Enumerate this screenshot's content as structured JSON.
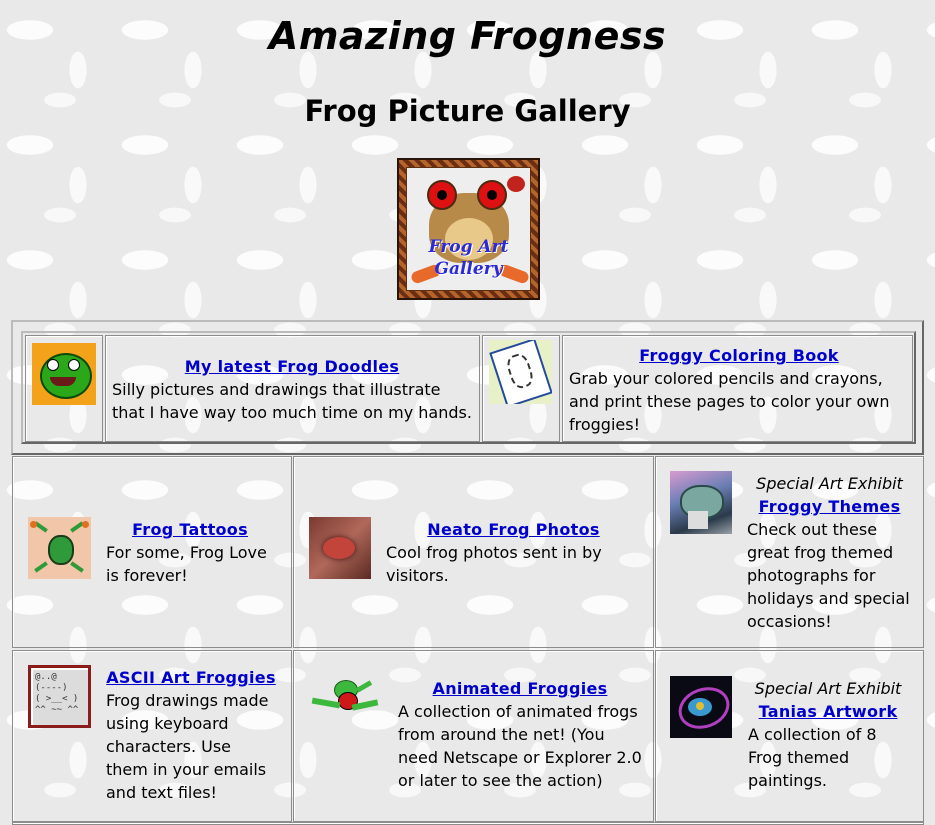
{
  "header": {
    "title": "Amazing Frogness",
    "subtitle": "Frog Picture Gallery"
  },
  "badge": {
    "line1": "Frog Art",
    "line2": "Gallery"
  },
  "featured": [
    {
      "link": "My latest Frog Doodles",
      "description": "Silly pictures and drawings that illustrate that I have way too much time on my hands.",
      "icon": "cartoon-frog-icon"
    },
    {
      "link": "Froggy Coloring Book",
      "description": "Grab your colored pencils and crayons, and print these pages to color your own froggies!",
      "icon": "coloring-book-icon"
    }
  ],
  "gallery": [
    {
      "link": "Frog Tattoos",
      "description": "For some, Frog Love is forever!",
      "icon": "frog-tattoo-icon"
    },
    {
      "link": "Neato Frog Photos",
      "description": "Cool frog photos sent in by visitors.",
      "icon": "frog-photo-icon"
    },
    {
      "exhibit": "Special Art Exhibit",
      "link": "Froggy Themes",
      "description": "Check out these great frog themed photographs for holidays and special occasions!",
      "icon": "froggy-themes-icon"
    },
    {
      "link": "ASCII Art Froggies",
      "description": "Frog drawings made using keyboard characters. Use them in your emails and text files!",
      "icon": "ascii-frog-icon",
      "ascii": "@..@\n(----)\n( >__< )\n^^ ~~ ^^"
    },
    {
      "link": "Animated Froggies",
      "description": "A collection of animated frogs from around the net! (You need Netscape or Explorer 2.0 or later to see the action)",
      "icon": "animated-frog-icon"
    },
    {
      "exhibit": "Special Art Exhibit",
      "link": "Tanias Artwork",
      "description": "A collection of 8 Frog themed paintings.",
      "icon": "tania-painting-icon"
    }
  ]
}
